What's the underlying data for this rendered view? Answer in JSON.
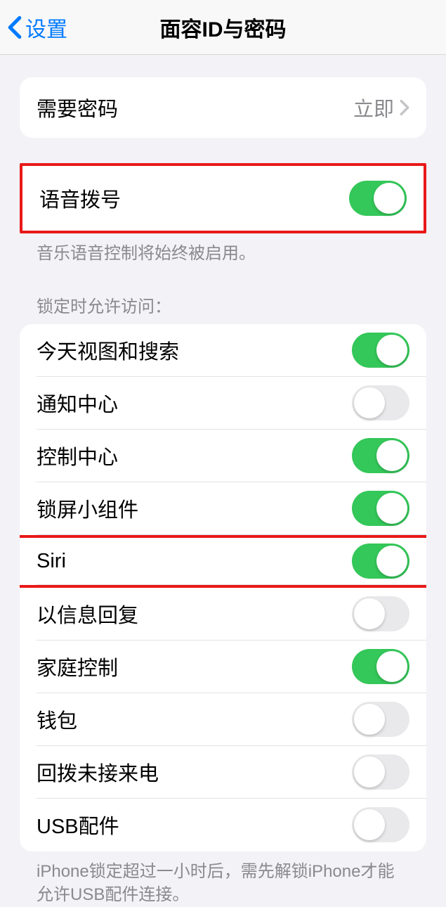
{
  "nav": {
    "back": "设置",
    "title": "面容ID与密码"
  },
  "requirePasscode": {
    "label": "需要密码",
    "value": "立即"
  },
  "voiceDial": {
    "label": "语音拨号",
    "footer": "音乐语音控制将始终被启用。",
    "on": true
  },
  "lockAccess": {
    "header": "锁定时允许访问：",
    "items": [
      {
        "label": "今天视图和搜索",
        "on": true
      },
      {
        "label": "通知中心",
        "on": false
      },
      {
        "label": "控制中心",
        "on": true
      },
      {
        "label": "锁屏小组件",
        "on": true
      },
      {
        "label": "Siri",
        "on": true,
        "highlight": true
      },
      {
        "label": "以信息回复",
        "on": false
      },
      {
        "label": "家庭控制",
        "on": true
      },
      {
        "label": "钱包",
        "on": false
      },
      {
        "label": "回拨未接来电",
        "on": false
      },
      {
        "label": "USB配件",
        "on": false
      }
    ],
    "footer": "iPhone锁定超过一小时后，需先解锁iPhone才能允许USB配件连接。"
  }
}
